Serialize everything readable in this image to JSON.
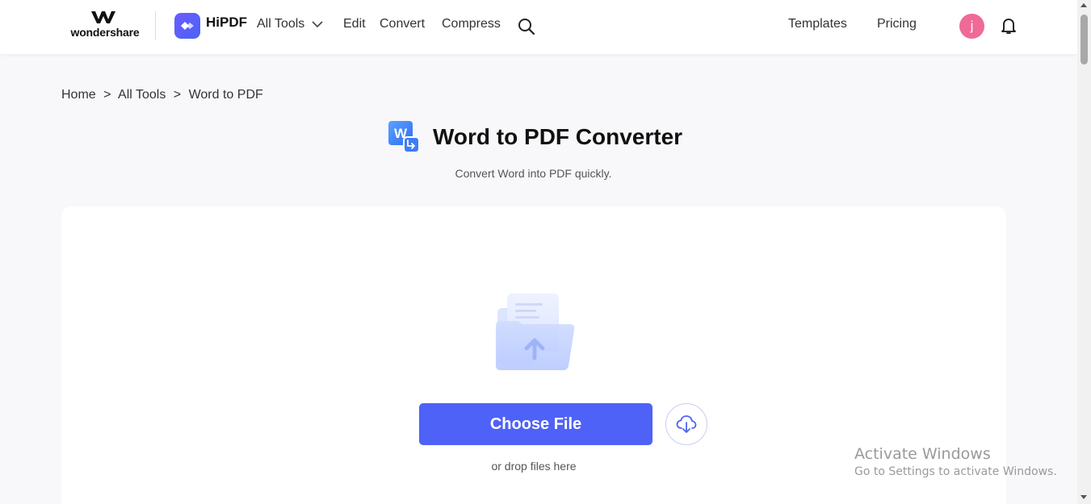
{
  "header": {
    "brand": "wondershare",
    "product": "HiPDF",
    "nav": {
      "all_tools": "All Tools",
      "edit": "Edit",
      "convert": "Convert",
      "compress": "Compress",
      "templates": "Templates",
      "pricing": "Pricing"
    },
    "avatar_initial": "j",
    "icons": [
      "wondershare-logo-icon",
      "hipdf-logo-icon",
      "chevron-down-icon",
      "search-icon",
      "bell-icon"
    ]
  },
  "breadcrumb": {
    "home": "Home",
    "all_tools": "All Tools",
    "current": "Word to PDF",
    "separator": ">"
  },
  "page": {
    "title": "Word to PDF Converter",
    "subtitle": "Convert Word into PDF quickly."
  },
  "upload": {
    "choose_label": "Choose File",
    "drop_text": "or drop files here",
    "icons": [
      "folder-upload-icon",
      "cloud-download-icon"
    ]
  },
  "watermark": {
    "title": "Activate Windows",
    "subtitle": "Go to Settings to activate Windows."
  },
  "colors": {
    "accent": "#4f62f7",
    "avatar": "#ef6a97",
    "word_icon": "#2f7bf5"
  }
}
